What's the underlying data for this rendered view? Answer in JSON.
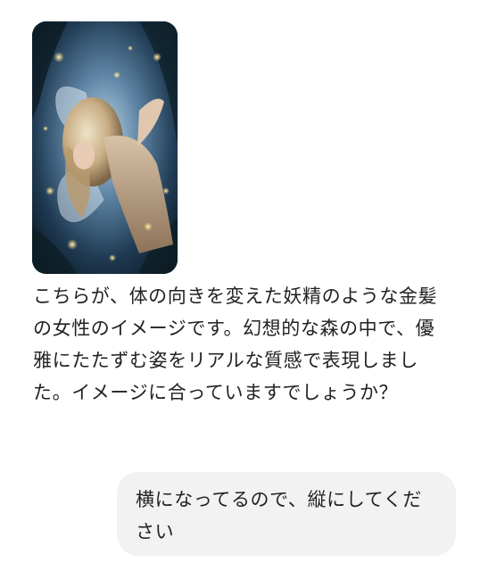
{
  "assistant_message": {
    "image": {
      "subject": "fairy-with-wings-illustration"
    },
    "text": "こちらが、体の向きを変えた妖精のような金髪の女性のイメージです。幻想的な森の中で、優雅にたたずむ姿をリアルな質感で表現しました。イメージに合っていますでしょうか？"
  },
  "user_message": {
    "text": "横になってるので、縦にしてください"
  },
  "colors": {
    "page_background": "#ffffff",
    "user_bubble": "#f2f2f2",
    "text": "#222222"
  }
}
